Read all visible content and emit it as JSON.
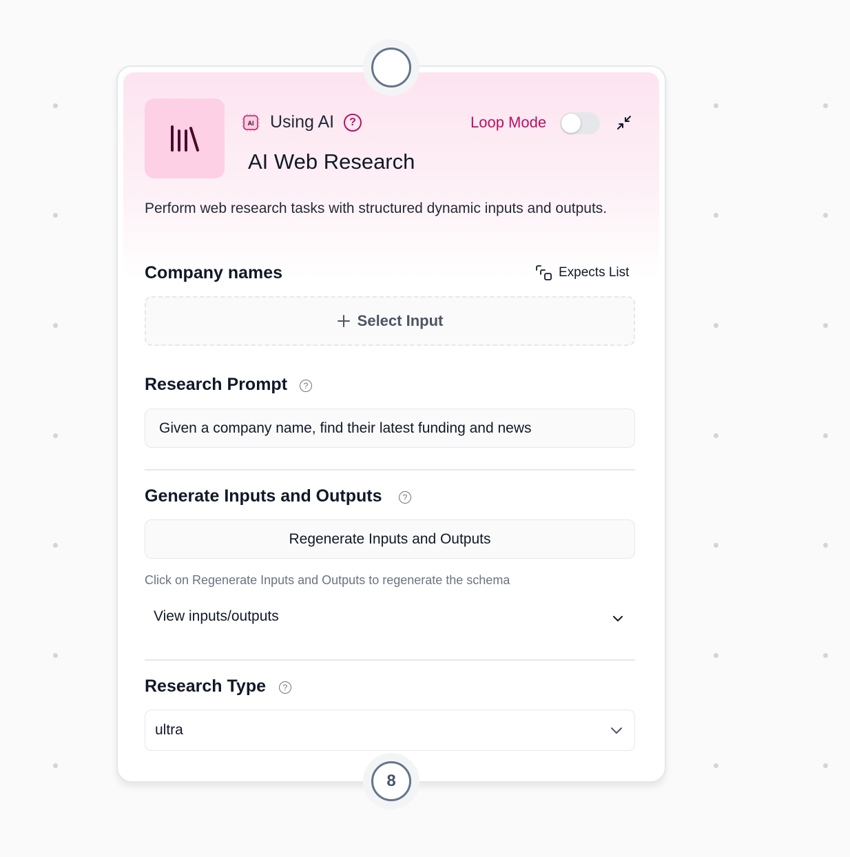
{
  "header": {
    "ai_badge": "AI",
    "using_ai_label": "Using AI",
    "help_glyph": "?",
    "loop_mode_label": "Loop Mode",
    "loop_mode_on": false,
    "title": "AI Web Research",
    "description": "Perform web research tasks with structured dynamic inputs and outputs."
  },
  "company_names": {
    "label": "Company names",
    "expects_list_label": "Expects List",
    "select_input_label": "Select Input"
  },
  "research_prompt": {
    "label": "Research Prompt",
    "help_glyph": "?",
    "value": "Given a company name, find their latest funding and news"
  },
  "generate_io": {
    "label": "Generate Inputs and Outputs",
    "help_glyph": "?",
    "regenerate_label": "Regenerate Inputs and Outputs",
    "hint": "Click on Regenerate Inputs and Outputs to regenerate the schema",
    "view_label": "View inputs/outputs"
  },
  "research_type": {
    "label": "Research Type",
    "help_glyph": "?",
    "selected": "ultra"
  },
  "handles": {
    "output_count": "8"
  },
  "colors": {
    "accent": "#be0e64",
    "icon_bg": "#fdd0e6",
    "handle_ring": "#64748b"
  },
  "icons": [
    "library-icon",
    "ai-chip-icon",
    "help-icon",
    "collapse-icon",
    "expects-list-icon",
    "plus-icon",
    "chevron-down-icon"
  ]
}
